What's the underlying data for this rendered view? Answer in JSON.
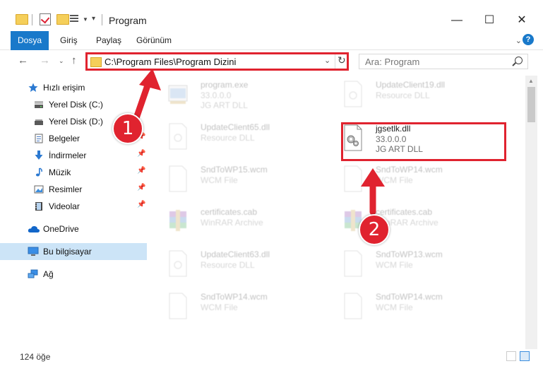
{
  "window": {
    "title": "Program",
    "minimize": "—",
    "maximize": "☐",
    "close": "✕"
  },
  "ribbon": {
    "tabs": [
      "Dosya",
      "Giriş",
      "Paylaş",
      "Görünüm"
    ],
    "help": "?"
  },
  "address": {
    "path": "C:\\Program Files\\Program Dizini"
  },
  "search": {
    "placeholder": "Ara: Program"
  },
  "sidebar": {
    "items": [
      {
        "label": "Hızlı erişim",
        "icon": "star-icon"
      },
      {
        "label": "Yerel Disk (C:)",
        "icon": "drive-icon"
      },
      {
        "label": "Yerel Disk (D:)",
        "icon": "drive-icon"
      },
      {
        "label": "Belgeler",
        "icon": "documents-icon"
      },
      {
        "label": "İndirmeler",
        "icon": "downloads-icon"
      },
      {
        "label": "Müzik",
        "icon": "music-icon"
      },
      {
        "label": "Resimler",
        "icon": "pictures-icon"
      },
      {
        "label": "Videolar",
        "icon": "videos-icon"
      },
      {
        "label": "OneDrive",
        "icon": "cloud-icon"
      },
      {
        "label": "Bu bilgisayar",
        "icon": "computer-icon"
      },
      {
        "label": "Ağ",
        "icon": "network-icon"
      }
    ]
  },
  "files": [
    {
      "name": "program.exe",
      "line1": "33.0.0.0",
      "line2": "JG ART DLL",
      "icon": "exe-icon"
    },
    {
      "name": "UpdateClient19.dll",
      "line1": "Resource DLL",
      "line2": "",
      "icon": "file-icon"
    },
    {
      "name": "UpdateClient65.dll",
      "line1": "Resource DLL",
      "line2": "",
      "icon": "file-icon"
    },
    {
      "name": "jgsetlk.dll",
      "line1": "33.0.0.0",
      "line2": "JG ART DLL",
      "icon": "dll-gear-icon"
    },
    {
      "name": "SndToWP15.wcm",
      "line1": "WCM File",
      "line2": "",
      "icon": "file-icon"
    },
    {
      "name": "SndToWP14.wcm",
      "line1": "WCM File",
      "line2": "",
      "icon": "file-icon"
    },
    {
      "name": "certificates.cab",
      "line1": "WinRAR Archive",
      "line2": "",
      "icon": "archive-icon"
    },
    {
      "name": "certificates.cab",
      "line1": "WinRAR Archive",
      "line2": "",
      "icon": "archive-icon"
    },
    {
      "name": "UpdateClient63.dll",
      "line1": "Resource DLL",
      "line2": "",
      "icon": "file-icon"
    },
    {
      "name": "SndToWP13.wcm",
      "line1": "WCM File",
      "line2": "",
      "icon": "file-icon"
    },
    {
      "name": "SndToWP14.wcm",
      "line1": "WCM File",
      "line2": "",
      "icon": "file-icon"
    },
    {
      "name": "SndToWP14.wcm",
      "line1": "WCM File",
      "line2": "",
      "icon": "file-icon"
    }
  ],
  "status": {
    "count": "124 öğe"
  },
  "annotations": {
    "step1": "1",
    "step2": "2",
    "color": "#e0232f"
  }
}
